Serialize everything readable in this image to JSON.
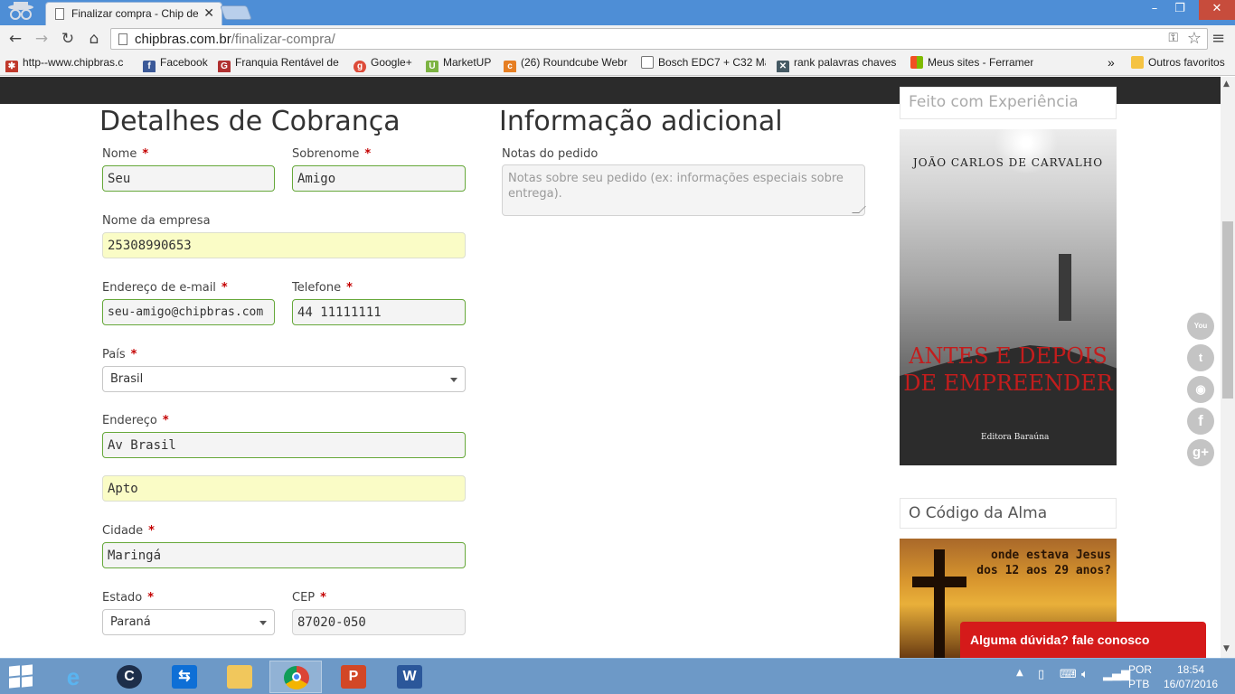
{
  "browser": {
    "tab_title": "Finalizar compra - Chip de",
    "url_host": "chipbras.com.br",
    "url_path": "/finalizar-compra/",
    "bookmarks": [
      {
        "label": "http--www.chipbras.c",
        "icon": "maple-leaf-icon"
      },
      {
        "label": "Facebook",
        "icon": "facebook-icon"
      },
      {
        "label": "Franquia Rentável de",
        "icon": "franquia-icon"
      },
      {
        "label": "Google+",
        "icon": "google-plus-icon"
      },
      {
        "label": "MarketUP",
        "icon": "marketup-icon"
      },
      {
        "label": "(26) Roundcube Webr",
        "icon": "roundcube-icon"
      },
      {
        "label": "Bosch EDC7 + C32 Ma",
        "icon": "page-icon"
      },
      {
        "label": "rank palavras chaves",
        "icon": "rank-icon"
      },
      {
        "label": "Meus sites - Ferramen",
        "icon": "windows-icon"
      }
    ],
    "more_bookmarks": "»",
    "other_bookmarks": "Outros favoritos"
  },
  "billing": {
    "heading": "Detalhes de Cobrança",
    "first_name": {
      "label": "Nome",
      "value": "Seu"
    },
    "last_name": {
      "label": "Sobrenome",
      "value": "Amigo"
    },
    "company": {
      "label": "Nome da empresa",
      "value": "25308990653"
    },
    "email": {
      "label": "Endereço de e-mail",
      "value": "seu-amigo@chipbras.com"
    },
    "phone": {
      "label": "Telefone",
      "value": "44 11111111"
    },
    "country": {
      "label": "País",
      "value": "Brasil"
    },
    "address": {
      "label": "Endereço",
      "value": "Av Brasil",
      "value2": "Apto"
    },
    "city": {
      "label": "Cidade",
      "value": "Maringá"
    },
    "state": {
      "label": "Estado",
      "value": "Paraná"
    },
    "zip": {
      "label": "CEP",
      "value": "87020-050"
    },
    "required_mark": "*"
  },
  "additional": {
    "heading": "Informação adicional",
    "notes_label": "Notas do pedido",
    "notes_placeholder": "Notas sobre seu pedido (ex: informações especiais sobre entrega)."
  },
  "sidebar": {
    "widget1_title": "Feito com Experiência",
    "book1_author": "João Carlos de Carvalho",
    "book1_title": "Antes e depois de empreender",
    "book1_publisher": "Editora Baraúna",
    "widget2_title": "O Código da Alma",
    "book2_text": "onde estava Jesus dos 12 aos 29 anos?"
  },
  "social": [
    "youtube-icon",
    "twitter-icon",
    "rss-icon",
    "facebook-icon",
    "google-plus-icon"
  ],
  "chat_label": "Alguma dúvida? fale conosco",
  "taskbar": {
    "lang1": "POR",
    "lang2": "PTB",
    "time": "18:54",
    "date": "16/07/2016"
  }
}
